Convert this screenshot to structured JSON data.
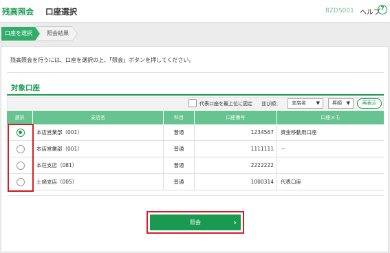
{
  "header": {
    "brand": "残高照会",
    "title": "口座選択",
    "screen_id": "BZDS001",
    "help_label": "ヘルプ",
    "help_icon": "?"
  },
  "steps": [
    {
      "label": "口座を選択",
      "active": true
    },
    {
      "label": "照会結果",
      "active": false
    }
  ],
  "instruction": "残高照会を行うには、口座を選択の上、「照会」ボタンを押してください。",
  "section_title": "対象口座",
  "toolbar": {
    "pin_label": "代表口座を最上位に固定",
    "sort_label": "並び順：",
    "sort_field": "支店名",
    "sort_order": "昇順",
    "caret": "▼",
    "redisplay_label": "再表示"
  },
  "table": {
    "headers": [
      "選択",
      "支店名",
      "科目",
      "口座番号",
      "口座メモ"
    ],
    "rows": [
      {
        "selected": true,
        "branch": "本店営業部（001）",
        "type": "普通",
        "number": "1234567",
        "memo": "資金移動用口座"
      },
      {
        "selected": false,
        "branch": "本店営業部（001）",
        "type": "普通",
        "number": "1111111",
        "memo": "－"
      },
      {
        "selected": false,
        "branch": "本荘支店（081）",
        "type": "普通",
        "number": "2222222",
        "memo": ""
      },
      {
        "selected": false,
        "branch": "土崎支店（005）",
        "type": "普通",
        "number": "1000314",
        "memo": "代表口座"
      }
    ]
  },
  "inquiry_button": {
    "label": "照会",
    "arrow": "›"
  },
  "colors": {
    "accent": "#1a9a51",
    "header_row": "#67c491",
    "highlight": "#d81c23"
  }
}
